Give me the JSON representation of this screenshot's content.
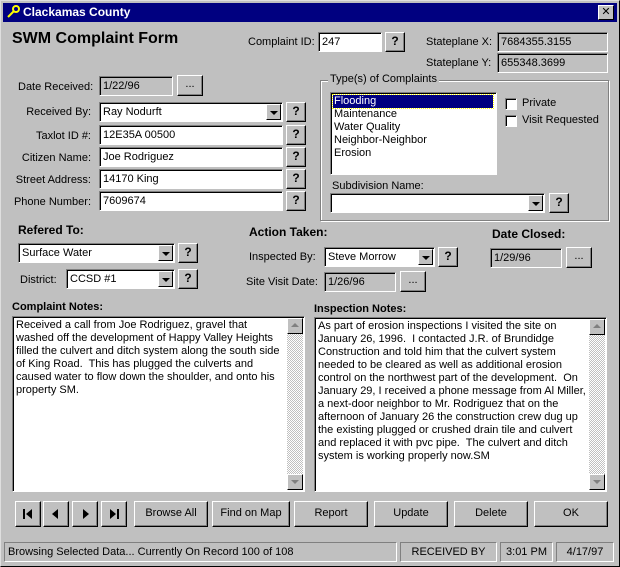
{
  "window": {
    "title": "Clackamas County",
    "close_label": "✕"
  },
  "form": {
    "heading": "SWM Complaint Form",
    "complaint_id_label": "Complaint ID:",
    "complaint_id": "247",
    "stateplane_x_label": "Stateplane X:",
    "stateplane_x": "7684355.3155",
    "stateplane_y_label": "Stateplane Y:",
    "stateplane_y": "655348.3699",
    "date_received_label": "Date Received:",
    "date_received": "1/22/96",
    "received_by_label": "Received By:",
    "received_by": "Ray Nodurft",
    "taxlot_label": "Taxlot ID #:",
    "taxlot": "12E35A 00500",
    "citizen_label": "Citizen Name:",
    "citizen": "Joe Rodriguez",
    "street_label": "Street Address:",
    "street": "14170 King",
    "phone_label": "Phone Number:",
    "phone": "7609674",
    "question_label": "?",
    "ellipsis_label": "..."
  },
  "complaint_types": {
    "group_label": "Type(s) of Complaints",
    "items": [
      "Flooding",
      "Maintenance",
      "Water Quality",
      "Neighbor-Neighbor",
      "Erosion"
    ],
    "selected": "Flooding",
    "private_label": "Private",
    "visit_requested_label": "Visit Requested",
    "subdivision_label": "Subdivision Name:",
    "subdivision": ""
  },
  "referred": {
    "heading": "Refered To:",
    "value": "Surface Water",
    "district_label": "District:",
    "district": "CCSD #1"
  },
  "action": {
    "heading": "Action Taken:",
    "inspected_by_label": "Inspected By:",
    "inspected_by": "Steve Morrow",
    "site_visit_label": "Site Visit Date:",
    "site_visit": "1/26/96"
  },
  "closed": {
    "heading": "Date Closed:",
    "value": "1/29/96"
  },
  "complaint_notes": {
    "heading": "Complaint Notes:",
    "text": "Received a call from Joe Rodriguez, gravel that washed off the development of Happy Valley Heights filled the culvert and ditch system along the south side of King Road.  This has plugged the culverts and caused water to flow down the shoulder, and onto his property SM."
  },
  "inspection_notes": {
    "heading": "Inspection Notes:",
    "text": "As part of erosion inspections I visited the site on January 26, 1996.  I contacted J.R. of Brundidge Construction and told him that the culvert system needed to be cleared as well as additional erosion control on the northwest part of the development.  On January 29, I received a phone message from Al Miller, a next-door neighbor to Mr. Rodriguez that on the afternoon of January 26 the construction crew dug up the existing plugged or crushed drain tile and culvert and replaced it with pvc pipe.  The culvert and ditch system is working properly now.SM"
  },
  "buttons": {
    "browse_all": "Browse All",
    "find_on_map": "Find on Map",
    "report": "Report",
    "update": "Update",
    "delete": "Delete",
    "ok": "OK"
  },
  "status": {
    "message": "Browsing Selected Data... Currently On Record 100 of 108",
    "field": "RECEIVED BY",
    "time": "3:01 PM",
    "date": "4/17/97"
  },
  "colors": {
    "titlebar": "#000080",
    "face": "#c0c0c0",
    "selection": "#000080"
  }
}
